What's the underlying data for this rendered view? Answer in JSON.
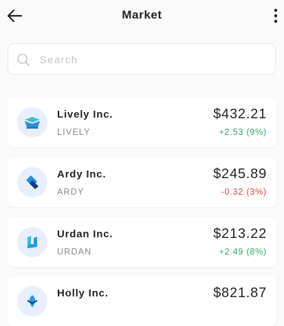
{
  "header": {
    "title": "Market"
  },
  "search": {
    "placeholder": "Search"
  },
  "colors": {
    "positive": "#2fa86a",
    "negative": "#e0403a"
  },
  "stocks": [
    {
      "name": "Lively Inc.",
      "ticker": "LIVELY",
      "price": "$432.21",
      "change": "+2.53 (9%)",
      "direction": "up",
      "logo_icon": "tray-logo-icon"
    },
    {
      "name": "Ardy Inc.",
      "ticker": "ARDY",
      "price": "$245.89",
      "change": "-0.32 (3%)",
      "direction": "down",
      "logo_icon": "diamond-logo-icon"
    },
    {
      "name": "Urdan Inc.",
      "ticker": "URDAN",
      "price": "$213.22",
      "change": "+2.49 (8%)",
      "direction": "up",
      "logo_icon": "u-shape-logo-icon"
    },
    {
      "name": "Holly Inc.",
      "ticker": "",
      "price": "$821.87",
      "change": "",
      "direction": "",
      "logo_icon": "leaf-logo-icon"
    }
  ]
}
